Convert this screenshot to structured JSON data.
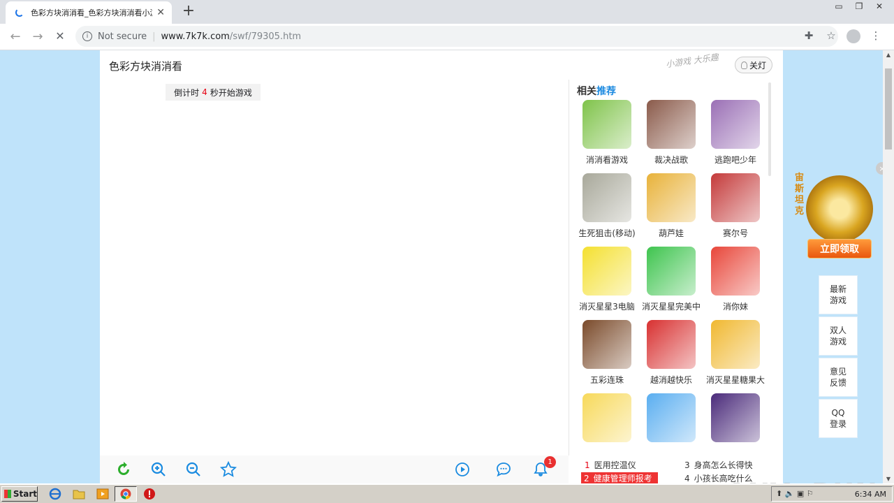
{
  "browser": {
    "tab_title": "色彩方块消消看_色彩方块消消看小游",
    "tab_close": "✕",
    "new_tab": "+",
    "security_text": "Not secure",
    "url_host": "www.7k7k.com",
    "url_path": "/swf/79305.htm",
    "info_glyph": "i",
    "min_glyph": "▭",
    "max_glyph": "❐",
    "close_glyph": "✕",
    "back_glyph": "←",
    "forward_glyph": "→",
    "stop_glyph": "✕",
    "extension_glyph": "✚",
    "star_glyph": "☆",
    "menu_glyph": "⋮"
  },
  "page": {
    "game_title": "色彩方块消消看",
    "brand_script": "小游戏 大乐趣",
    "light_button": "关灯",
    "countdown_prefix": "倒计时",
    "countdown_number": "4",
    "countdown_suffix": "秒开始游戏",
    "notification_badge": "1"
  },
  "sidebar": {
    "title_main": "相关",
    "title_highlight": "推荐",
    "games": [
      {
        "name": "消消看游戏",
        "icon": "match-game-icon",
        "color": "#7fc34a"
      },
      {
        "name": "裁决战歌",
        "icon": "warrior-woman-icon",
        "color": "#8a5a4a"
      },
      {
        "name": "逃跑吧少年",
        "icon": "running-boys-icon",
        "color": "#9a6fb5"
      },
      {
        "name": "生死狙击(移动)",
        "icon": "sniper-icon",
        "color": "#a8a89a"
      },
      {
        "name": "葫芦娃",
        "icon": "gourd-kid-icon",
        "color": "#e8b23a"
      },
      {
        "name": "赛尔号",
        "icon": "robot-icon",
        "color": "#c43a3a"
      },
      {
        "name": "消灭星星3电脑",
        "icon": "stars-icon",
        "color": "#f4e030"
      },
      {
        "name": "消灭星星完美中",
        "icon": "stars-green-icon",
        "color": "#3ec44e"
      },
      {
        "name": "消你妹",
        "icon": "fruits-icon",
        "color": "#e8463a"
      },
      {
        "name": "五彩连珠",
        "icon": "color-balls-icon",
        "color": "#7a4a2a"
      },
      {
        "name": "越消越快乐",
        "icon": "red-blocks-icon",
        "color": "#d83030"
      },
      {
        "name": "消灭星星糖果大",
        "icon": "candy-icon",
        "color": "#f0b830"
      },
      {
        "name": "",
        "icon": "fruit-faces-icon",
        "color": "#f7d95a"
      },
      {
        "name": "",
        "icon": "cupcakes-icon",
        "color": "#5aaef0"
      },
      {
        "name": "",
        "icon": "block-tower-icon",
        "color": "#4a2a7a"
      }
    ]
  },
  "hot_list": [
    {
      "num": "1",
      "text": "医用控温仪"
    },
    {
      "num": "3",
      "text": "身高怎么长得快"
    },
    {
      "num": "2",
      "text": "健康管理师报考"
    },
    {
      "num": "4",
      "text": "小孩长高吃什么"
    }
  ],
  "promo": {
    "vertical_text": "宙斯坦克",
    "button": "立即领取",
    "close": "×"
  },
  "float_menu": [
    "最新游戏",
    "双人游戏",
    "意见反馈",
    "QQ登录"
  ],
  "watermark": "ANY▷RUN",
  "taskbar": {
    "start": "Start",
    "clock": "6:34 AM"
  }
}
